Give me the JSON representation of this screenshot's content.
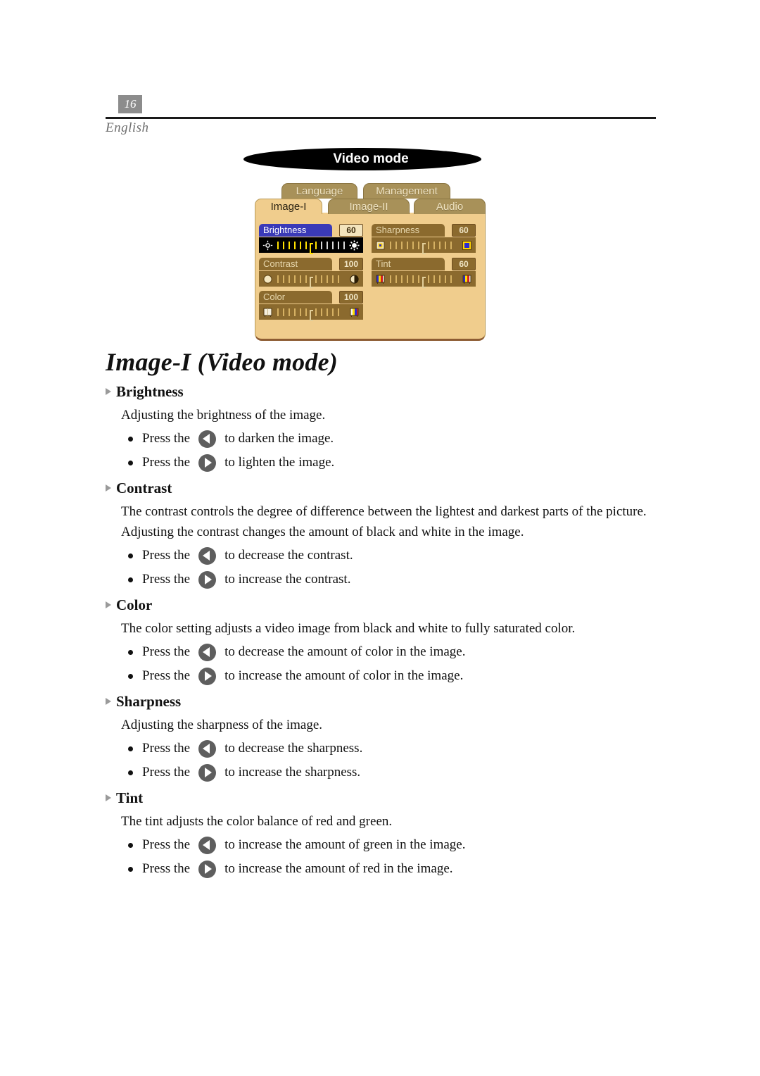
{
  "header": {
    "page_number": "16",
    "language_label": "English"
  },
  "figure": {
    "banner_label": "Video mode",
    "tabs_back": [
      {
        "label": "Language",
        "active": false
      },
      {
        "label": "Management",
        "active": false
      }
    ],
    "tabs_front": [
      {
        "label": "Image-I",
        "active": true
      },
      {
        "label": "Image-II",
        "active": false
      },
      {
        "label": "Audio",
        "active": false
      }
    ],
    "sliders": [
      {
        "name": "Brightness",
        "value": "60",
        "active": true,
        "icon_left": "sun-small-icon",
        "icon_right": "sun-bright-icon"
      },
      {
        "name": "Contrast",
        "value": "100",
        "active": false,
        "icon_left": "circle-dim-icon",
        "icon_right": "circle-half-icon"
      },
      {
        "name": "Color",
        "value": "100",
        "active": false,
        "icon_left": "palette-pale-icon",
        "icon_right": "palette-color-icon"
      },
      {
        "name": "Sharpness",
        "value": "60",
        "active": false,
        "icon_left": "square-soft-icon",
        "icon_right": "square-sharp-icon"
      },
      {
        "name": "Tint",
        "value": "60",
        "active": false,
        "icon_left": "tint-bars-icon",
        "icon_right": "tint-bars-icon"
      }
    ],
    "colors": {
      "panel_bg": "#f0cd8d",
      "track_brown": "#8b6a2e",
      "tab_inactive": "#a89159",
      "active_label_blue": "#3a3ab8",
      "active_tick_yellow": "#ffe100",
      "panel_border_dark": "#8d5c33"
    }
  },
  "document": {
    "title": "Image-I (Video mode)",
    "sections": [
      {
        "heading": "Brightness",
        "body": "Adjusting the brightness of the image.",
        "items": [
          {
            "prefix": "Press the",
            "icon": "arrow-left-icon",
            "suffix": "to darken the image."
          },
          {
            "prefix": "Press the",
            "icon": "arrow-right-icon",
            "suffix": "to lighten the image."
          }
        ]
      },
      {
        "heading": "Contrast",
        "body": "The contrast controls the degree of difference between the lightest and darkest parts of  the picture. Adjusting  the contrast changes the amount of black and white in the image.",
        "items": [
          {
            "prefix": "Press the",
            "icon": "arrow-left-icon",
            "suffix": "to decrease the contrast."
          },
          {
            "prefix": "Press the",
            "icon": "arrow-right-icon",
            "suffix": "to increase the contrast."
          }
        ]
      },
      {
        "heading": "Color",
        "body": "The color setting adjusts a video image from black and white to fully saturated color.",
        "items": [
          {
            "prefix": "Press the",
            "icon": "arrow-left-icon",
            "suffix": "to decrease the amount of color in the image."
          },
          {
            "prefix": "Press the",
            "icon": "arrow-right-icon",
            "suffix": "to increase the amount of color in the image."
          }
        ]
      },
      {
        "heading": "Sharpness",
        "body": "Adjusting the sharpness of the image.",
        "items": [
          {
            "prefix": "Press the",
            "icon": "arrow-left-icon",
            "suffix": "to decrease the sharpness."
          },
          {
            "prefix": "Press the",
            "icon": "arrow-right-icon",
            "suffix": "to increase the sharpness."
          }
        ]
      },
      {
        "heading": "Tint",
        "body": "The tint adjusts the color balance of red and green.",
        "items": [
          {
            "prefix": "Press the",
            "icon": "arrow-left-icon",
            "suffix": "to increase the amount of green in the image."
          },
          {
            "prefix": "Press the",
            "icon": "arrow-right-icon",
            "suffix": "to increase the amount of red  in the image."
          }
        ]
      }
    ]
  }
}
